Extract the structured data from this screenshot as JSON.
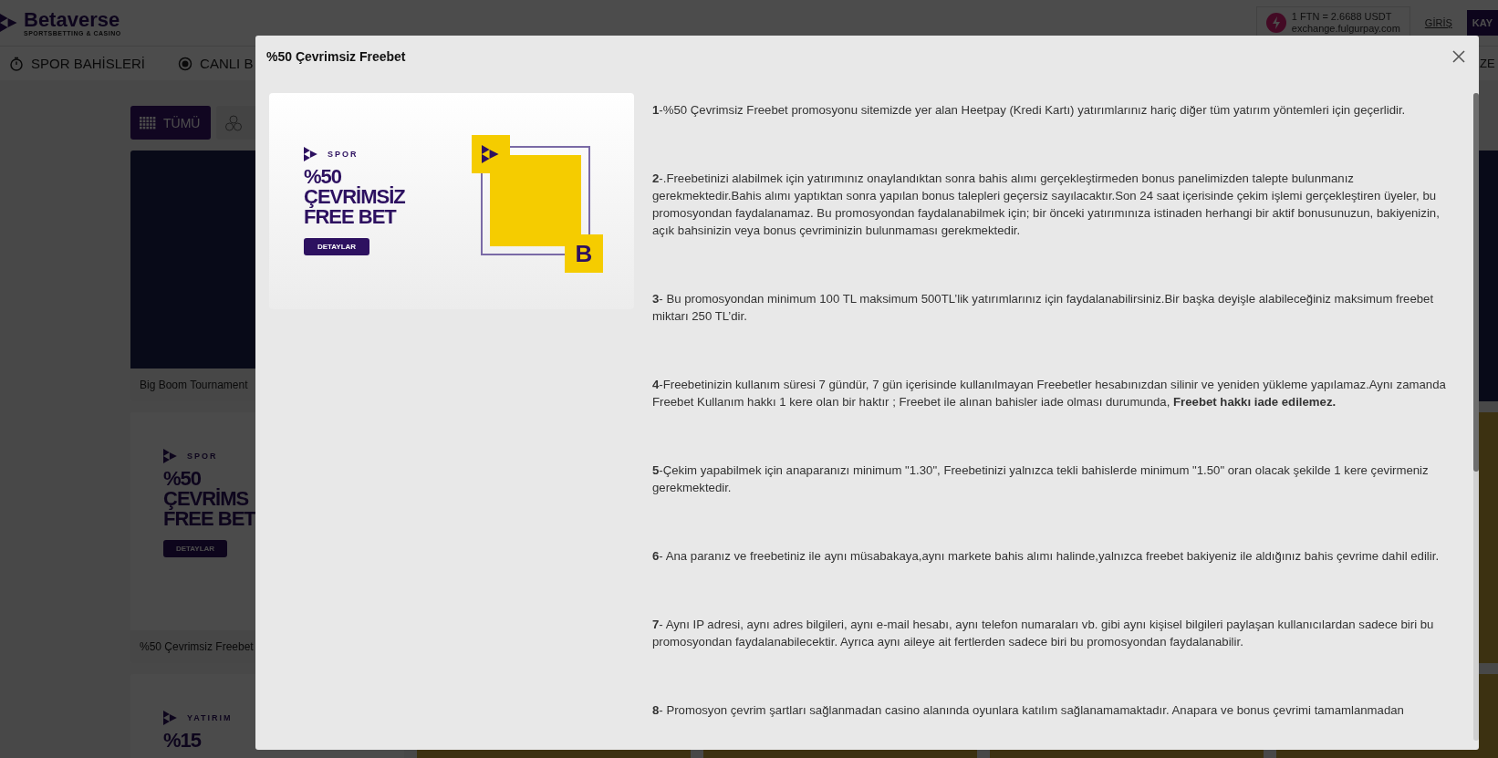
{
  "page": {
    "logo": "Betaverse",
    "logo_tagline": "SPORTSBETTING & CASINO",
    "rate": "1 FTN = 2.6688 USDT",
    "rate_source": "exchange.fulgurpay.com",
    "login": "GİRİŞ",
    "register": "KAY",
    "nav": [
      {
        "label": "SPOR BAHİSLERİ",
        "kind": "stopwatch"
      },
      {
        "label": "CANLI B",
        "kind": "live"
      }
    ],
    "nav_right": "ZE",
    "filters": [
      {
        "label": "TÜMÜ",
        "selected": true
      },
      {
        "selected": false
      }
    ],
    "cards": [
      {
        "kind": "photo",
        "caption": "Big Boom Tournament"
      },
      {
        "kind": "banner",
        "tag": "SPOR",
        "headline": [
          "%50",
          "ÇEVRİMS",
          "FREE BET"
        ],
        "button": "DETAYLAR",
        "caption": "%50 Çevrimsiz Freebet"
      },
      {
        "kind": "banner",
        "tag": "YATIRIM",
        "headline": [
          "%15"
        ]
      }
    ]
  },
  "modal": {
    "title": "%50 Çevrimsiz Freebet",
    "banner": {
      "tag": "SPOR",
      "headline": [
        "%50",
        "ÇEVRİMSİZ",
        "FREE BET"
      ],
      "button": "DETAYLAR",
      "badge": "B"
    },
    "rules": [
      "**1**-%50 Çevrimsiz Freebet promosyonu sitemizde yer alan Heetpay (Kredi Kartı) yatırımlarınız hariç diğer tüm yatırım yöntemleri için geçerlidir.",
      "**2**-.Freebetinizi alabilmek için yatırımınız onaylandıktan sonra bahis alımı gerçekleştirmeden bonus panelimizden talepte bulunmanız gerekmektedir.Bahis alımı yaptıktan sonra yapılan bonus talepleri geçersiz sayılacaktır.Son 24 saat içerisinde çekim işlemi gerçekleştiren üyeler, bu promosyondan faydalanamaz. Bu promosyondan faydalanabilmek için; bir önceki yatırımınıza istinaden herhangi bir aktif bonusunuzun, bakiyenizin, açık bahsinizin veya bonus çevriminizin bulunmaması gerekmektedir.",
      "**3**- Bu promosyondan minimum 100 TL maksimum 500TL’lik yatırımlarınız için faydalanabilirsiniz.Bir başka deyişle alabileceğiniz maksimum freebet miktarı 250 TL’dir.",
      "**4**-Freebetinizin kullanım süresi 7 gündür, 7 gün içerisinde kullanılmayan Freebetler hesabınızdan silinir ve yeniden yükleme yapılamaz.Aynı zamanda Freebet Kullanım hakkı 1 kere olan bir haktır ; Freebet ile alınan bahisler iade olması durumunda, **Freebet hakkı iade edilemez.**",
      "**5**-Çekim yapabilmek için anaparanızı minimum \"1.30\", Freebetinizi yalnızca tekli bahislerde minimum \"1.50\" oran olacak şekilde 1 kere çevirmeniz gerekmektedir.",
      "**6**- Ana paranız ve freebetiniz ile aynı müsabakaya,aynı markete bahis alımı halinde,yalnızca freebet bakiyeniz ile aldığınız bahis çevrime dahil edilir.",
      "**7**- Aynı IP adresi, aynı adres bilgileri, aynı e-mail hesabı, aynı telefon numaraları vb. gibi aynı kişisel bilgileri paylaşan kullanıcılardan sadece biri bu promosyondan faydalanabilecektir. Ayrıca aynı aileye ait fertlerden sadece biri bu promosyondan faydalanabilir.",
      "**8**- Promosyon çevrim şartları sağlanmadan casino alanında oyunlara katılım sağlanamamaktadır. Anapara ve bonus çevrimi tamamlanmadan"
    ]
  }
}
